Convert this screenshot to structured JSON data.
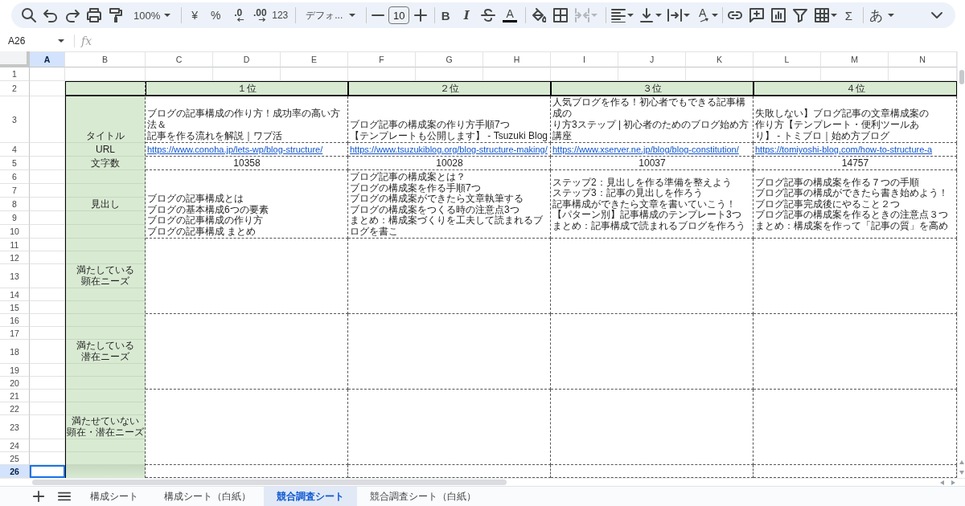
{
  "toolbar": {
    "zoom": "100%",
    "currency": "¥",
    "percent": "%",
    "decrease_decimal": ".0",
    "increase_decimal": ".00",
    "number_format": "123",
    "font": "デフォ...",
    "font_size": "10",
    "bold": "B",
    "italic": "I",
    "text_color": "A",
    "merge_disabled": true,
    "text_rotation": "A",
    "functions": "Σ",
    "input_tools": "あ"
  },
  "formula_bar": {
    "cell_ref": "A26",
    "fx": "fx"
  },
  "columns": [
    {
      "label": "A",
      "selected": true
    },
    {
      "label": "B",
      "selected": false
    },
    {
      "label": "C",
      "selected": false
    },
    {
      "label": "D",
      "selected": false
    },
    {
      "label": "E",
      "selected": false
    },
    {
      "label": "F",
      "selected": false
    },
    {
      "label": "G",
      "selected": false
    },
    {
      "label": "H",
      "selected": false
    },
    {
      "label": "I",
      "selected": false
    },
    {
      "label": "J",
      "selected": false
    },
    {
      "label": "K",
      "selected": false
    },
    {
      "label": "L",
      "selected": false
    },
    {
      "label": "M",
      "selected": false
    },
    {
      "label": "N",
      "selected": false
    }
  ],
  "rows": [
    {
      "label": "1",
      "selected": false
    },
    {
      "label": "2",
      "selected": false
    },
    {
      "label": "3",
      "selected": false
    },
    {
      "label": "4",
      "selected": false
    },
    {
      "label": "5",
      "selected": false
    },
    {
      "label": "6",
      "selected": false
    },
    {
      "label": "7",
      "selected": false
    },
    {
      "label": "8",
      "selected": false
    },
    {
      "label": "9",
      "selected": false
    },
    {
      "label": "10",
      "selected": false
    },
    {
      "label": "11",
      "selected": false
    },
    {
      "label": "12",
      "selected": false
    },
    {
      "label": "13",
      "selected": false
    },
    {
      "label": "14",
      "selected": false
    },
    {
      "label": "15",
      "selected": false
    },
    {
      "label": "16",
      "selected": false
    },
    {
      "label": "17",
      "selected": false
    },
    {
      "label": "18",
      "selected": false
    },
    {
      "label": "19",
      "selected": false
    },
    {
      "label": "20",
      "selected": false
    },
    {
      "label": "21",
      "selected": false
    },
    {
      "label": "22",
      "selected": false
    },
    {
      "label": "23",
      "selected": false
    },
    {
      "label": "24",
      "selected": false
    },
    {
      "label": "25",
      "selected": false
    },
    {
      "label": "26",
      "selected": true
    }
  ],
  "rank_headers": [
    "１位",
    "２位",
    "３位",
    "４位"
  ],
  "row_labels": [
    [
      "タイトル"
    ],
    [
      "URL"
    ],
    [
      "文字数"
    ],
    [
      "見出し"
    ],
    [
      "満たしている",
      "顕在ニーズ"
    ],
    [
      "満たしている",
      "潜在ニーズ"
    ],
    [
      "満たせていない",
      "顕在・潜在ニーズ"
    ]
  ],
  "sites": [
    {
      "title": [
        "ブログの記事構成の作り方！成功率の高い方法＆",
        "記事を作る流れを解説｜ワプ活"
      ],
      "url": "https://www.conoha.jp/lets-wp/blog-structure/",
      "char_count": "10358",
      "headings": [
        "ブログの記事構成とは",
        "ブログの基本構成6つの要素",
        "ブログの記事構成の作り方",
        "ブログの記事構成 まとめ"
      ]
    },
    {
      "title": [
        "ブログ記事の構成案の作り方手順7つ",
        "【テンプレートも公開します】 - Tsuzuki Blog"
      ],
      "url": "https://www.tsuzukiblog.org/blog-structure-making/",
      "char_count": "10028",
      "headings": [
        "ブログ記事の構成案とは？",
        "ブログの構成案を作る手順7つ",
        "ブログの構成案ができたら文章執筆する",
        "ブログの構成案をつくる時の注意点3つ",
        "まとめ：構成案づくりを工夫して読まれるブログを書こ"
      ]
    },
    {
      "title": [
        "人気ブログを作る！初心者でもできる記事構成の",
        "り方3ステップ | 初心者のためのブログ始め方講座"
      ],
      "url": "https://www.xserver.ne.jp/blog/blog-constitution/",
      "char_count": "10037",
      "headings": [
        "ステップ2：見出しを作る準備を整えよう",
        "ステップ3：記事の見出しを作ろう",
        "記事構成ができたら文章を書いていこう！",
        "【パターン別】記事構成のテンプレート3つ",
        "まとめ：記事構成で読まれるブログを作ろう"
      ]
    },
    {
      "title": [
        "失敗しない】ブログ記事の文章構成案の",
        "作り方【テンプレート・便利ツールあ",
        "り】 - トミブロ｜始め方ブログ"
      ],
      "url": "https://tomiyoshi-blog.com/how-to-structure-a",
      "char_count": "14757",
      "headings": [
        "ブログ記事の構成案を作る７つの手順",
        "ブログ記事の構成ができたら書き始めよう！",
        "ブログ記事完成後にやること２つ",
        "ブログ記事の構成案を作るときの注意点３つ",
        "まとめ：構成案を作って「記事の質」を高め"
      ]
    }
  ],
  "sheet_tabs": [
    {
      "label": "構成シート",
      "selected": false
    },
    {
      "label": "構成シート（白紙）",
      "selected": false
    },
    {
      "label": "競合調査シート",
      "selected": true
    },
    {
      "label": "競合調査シート（白紙）",
      "selected": false
    }
  ]
}
